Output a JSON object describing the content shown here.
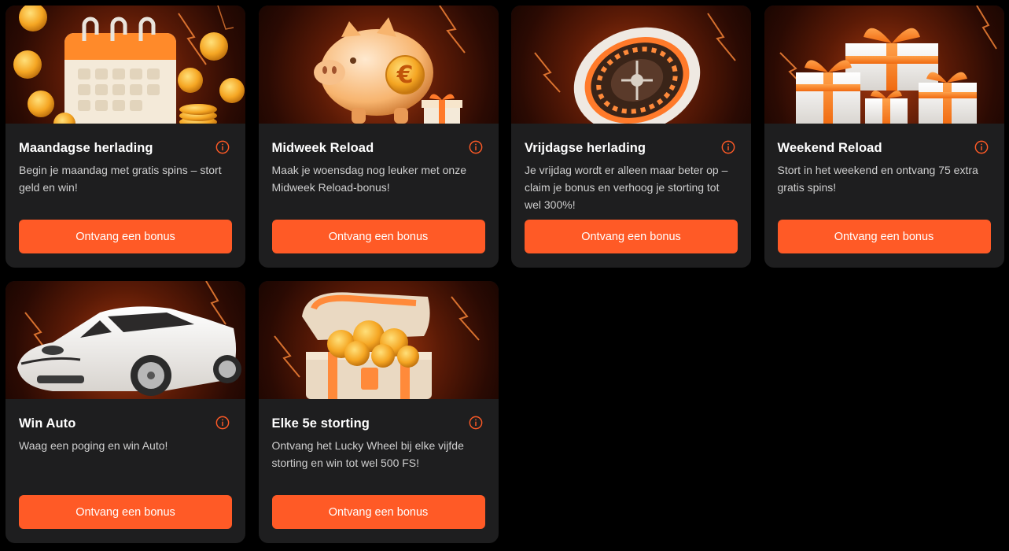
{
  "colors": {
    "accent": "#ff5a26",
    "card_bg": "#1e1e1f",
    "page_bg": "#000000"
  },
  "cards": [
    {
      "title": "Maandagse herlading",
      "description": "Begin je maandag met gratis spins – stort geld en win!",
      "button_label": "Ontvang een bonus",
      "image": "calendar-coins-icon"
    },
    {
      "title": "Midweek Reload",
      "description": "Maak je woensdag nog leuker met onze Midweek Reload-bonus!",
      "button_label": "Ontvang een bonus",
      "image": "piggy-bank-icon"
    },
    {
      "title": "Vrijdagse herlading",
      "description": "Je vrijdag wordt er alleen maar beter op – claim je bonus en verhoog je storting tot wel 300%!",
      "button_label": "Ontvang een bonus",
      "image": "roulette-wheel-icon"
    },
    {
      "title": "Weekend Reload",
      "description": "Stort in het weekend en ontvang 75 extra gratis spins!",
      "button_label": "Ontvang een bonus",
      "image": "gift-boxes-icon"
    },
    {
      "title": "Win Auto",
      "description": "Waag een poging en win Auto!",
      "button_label": "Ontvang een bonus",
      "image": "sports-car-icon"
    },
    {
      "title": "Elke 5e storting",
      "description": "Ontvang het Lucky Wheel bij elke vijfde storting en win tot wel 500 FS!",
      "button_label": "Ontvang een bonus",
      "image": "treasure-chest-icon"
    }
  ]
}
